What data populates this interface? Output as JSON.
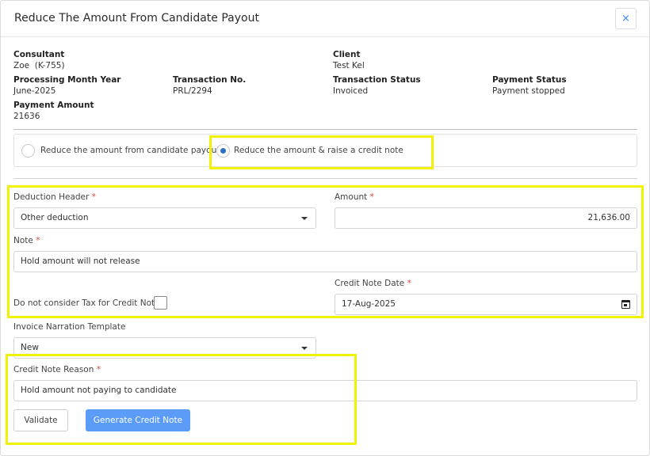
{
  "modal": {
    "title": "Reduce The Amount From Candidate Payout",
    "close_icon": "×"
  },
  "summary": {
    "consultant_label": "Consultant",
    "consultant_value": "Zoe  (K-755)",
    "client_label": "Client",
    "client_value": "Test Kel",
    "processing_label": "Processing Month Year",
    "processing_value": "June-2025",
    "transaction_no_label": "Transaction No.",
    "transaction_no_value": "PRL/2294",
    "transaction_status_label": "Transaction Status",
    "transaction_status_value": "Invoiced",
    "payment_status_label": "Payment Status",
    "payment_status_value": "Payment stopped",
    "payment_amount_label": "Payment Amount",
    "payment_amount_value": "21636"
  },
  "options": {
    "option1_label": "Reduce the amount from candidate payout",
    "option2_label": "Reduce the amount & raise a credit note",
    "selected": "option2"
  },
  "form": {
    "deduction_header_label": "Deduction Header",
    "deduction_header_value": "Other deduction",
    "amount_label": "Amount",
    "amount_value": "21,636.00",
    "note_label": "Note",
    "note_value": "Hold amount will not release",
    "credit_note_date_label": "Credit Note Date",
    "credit_note_date_value": "17-Aug-2025",
    "no_tax_label": "Do not consider Tax for Credit Note",
    "no_tax_checked": false,
    "narration_template_label": "Invoice Narration Template",
    "narration_template_value": "New",
    "credit_note_reason_label": "Credit Note Reason",
    "credit_note_reason_value": "Hold amount not paying to candidate",
    "required_marker": "*"
  },
  "buttons": {
    "validate": "Validate",
    "generate": "Generate Credit Note"
  },
  "colors": {
    "primary": "#5a9cf8",
    "required": "#e0433b",
    "highlight": "#f2f200"
  }
}
